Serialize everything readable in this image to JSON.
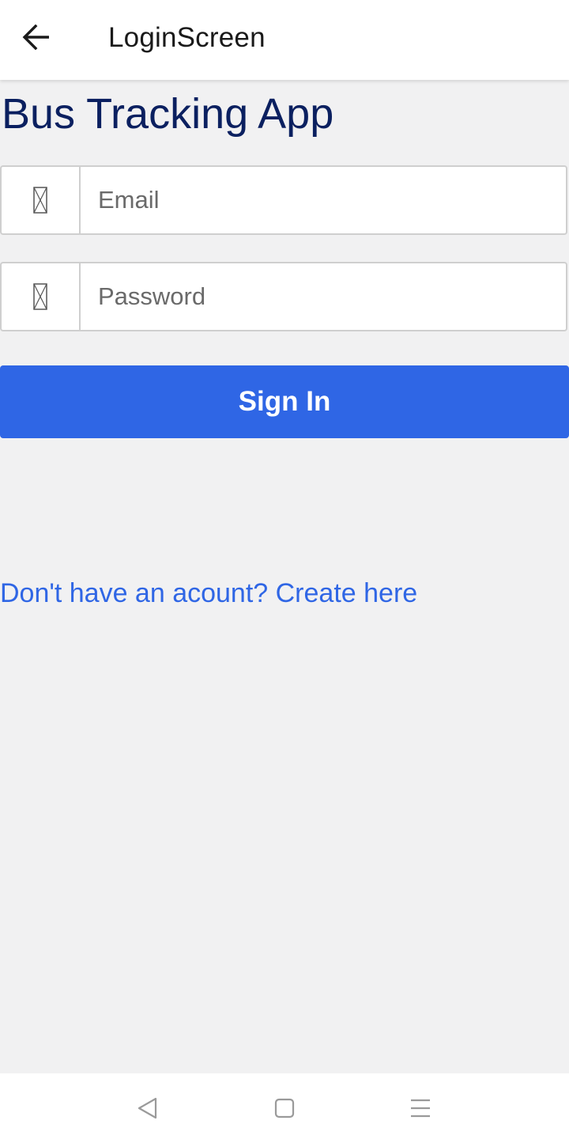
{
  "app_bar": {
    "title": "LoginScreen",
    "back_icon": "arrow-left-icon"
  },
  "heading": "Bus Tracking App",
  "form": {
    "email": {
      "placeholder": "Email",
      "value": "",
      "icon": "missing-glyph-icon"
    },
    "password": {
      "placeholder": "Password",
      "value": "",
      "icon": "missing-glyph-icon"
    },
    "sign_in_label": "Sign In"
  },
  "create_account_link": "Don't have an acount? Create here",
  "colors": {
    "accent": "#2f66e5",
    "heading": "#0b2060",
    "background": "#f1f1f2"
  },
  "nav_bar": {
    "buttons": [
      "nav-back-icon",
      "nav-home-icon",
      "nav-menu-icon"
    ]
  }
}
